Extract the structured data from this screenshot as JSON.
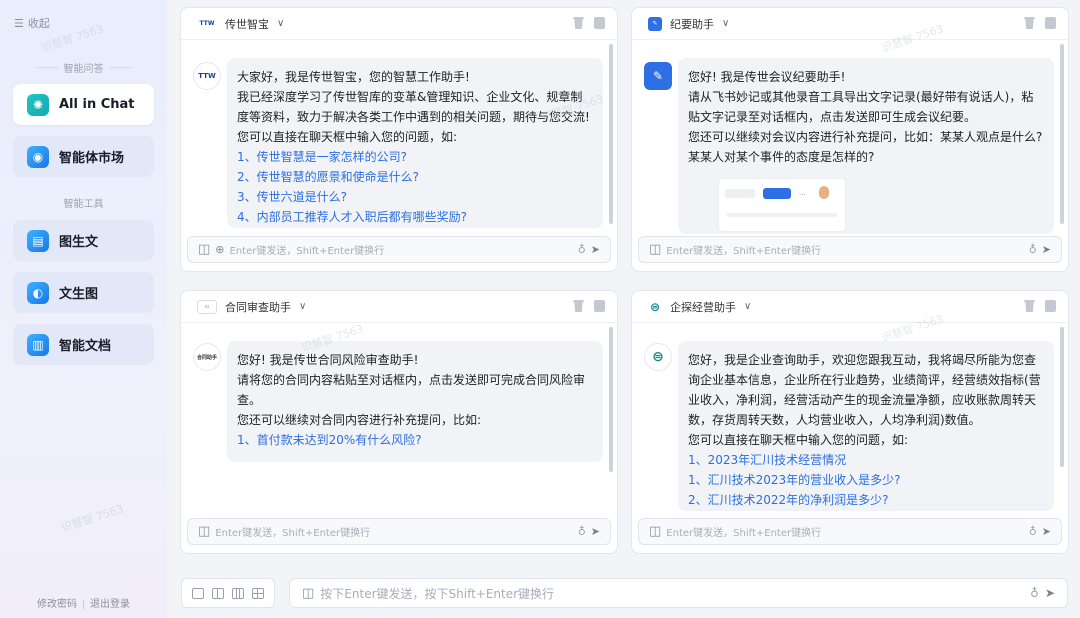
{
  "sidebar": {
    "collapse_label": "收起",
    "section_chat": "智能问答",
    "section_tools": "智能工具",
    "items": [
      {
        "label": "All in Chat"
      },
      {
        "label": "智能体市场"
      },
      {
        "label": "图生文"
      },
      {
        "label": "文生图"
      },
      {
        "label": "智能文档"
      }
    ],
    "footer_change_password": "修改密码",
    "footer_logout": "退出登录"
  },
  "panels": [
    {
      "title": "传世智宝",
      "logo": "TTW",
      "lines": [
        "大家好，我是传世智宝，您的智慧工作助手!",
        "我已经深度学习了传世智库的变革&管理知识、企业文化、规章制度等资料，致力于解决各类工作中遇到的相关问题，期待与您交流!",
        "您可以直接在聊天框中输入您的问题，如:"
      ],
      "questions": [
        "1、传世智慧是一家怎样的公司?",
        "2、传世智慧的愿景和使命是什么?",
        "3、传世六道是什么?",
        "4、内部员工推荐人才入职后都有哪些奖励?"
      ],
      "input_placeholder": "Enter键发送，Shift+Enter键换行"
    },
    {
      "title": "纪要助手",
      "lines": [
        "您好! 我是传世会议纪要助手!",
        "请从飞书妙记或其他录音工具导出文字记录(最好带有说话人)，粘贴文字记录至对话框内，点击发送即可生成会议纪要。",
        "您还可以继续对会议内容进行补充提问，比如：某某人观点是什么?某某人对某个事件的态度是怎样的?"
      ],
      "mini_share": "分享",
      "input_placeholder": "Enter键发送，Shift+Enter键换行"
    },
    {
      "title": "合同审查助手",
      "logo": "合同助手",
      "lines": [
        "您好! 我是传世合同风险审查助手!",
        "请将您的合同内容粘贴至对话框内，点击发送即可完成合同风险审查。",
        "您还可以继续对合同内容进行补充提问，比如:"
      ],
      "questions": [
        "1、首付款未达到20%有什么风险?"
      ],
      "input_placeholder": "Enter键发送，Shift+Enter键换行"
    },
    {
      "title": "企探经营助手",
      "lines": [
        "您好，我是企业查询助手，欢迎您跟我互动，我将竭尽所能为您查询企业基本信息，企业所在行业趋势，业绩简评，经营绩效指标(营业收入，净利润，经营活动产生的现金流量净额，应收账款周转天数，存货周转天数，人均营业收入，人均净利润)数值。",
        "您可以直接在聊天框中输入您的问题，如:"
      ],
      "questions": [
        "1、2023年汇川技术经营情况",
        "1、汇川技术2023年的营业收入是多少?",
        "2、汇川技术2022年的净利润是多少?"
      ],
      "input_placeholder": "Enter键发送，Shift+Enter键换行"
    }
  ],
  "bottom": {
    "input_placeholder": "按下Enter键发送，按下Shift+Enter键换行"
  },
  "watermark": "识慧智 7563",
  "colors": {
    "link": "#2c6fe0",
    "accent_teal": "#1bb6bc",
    "accent_blue": "#1d86ee"
  }
}
